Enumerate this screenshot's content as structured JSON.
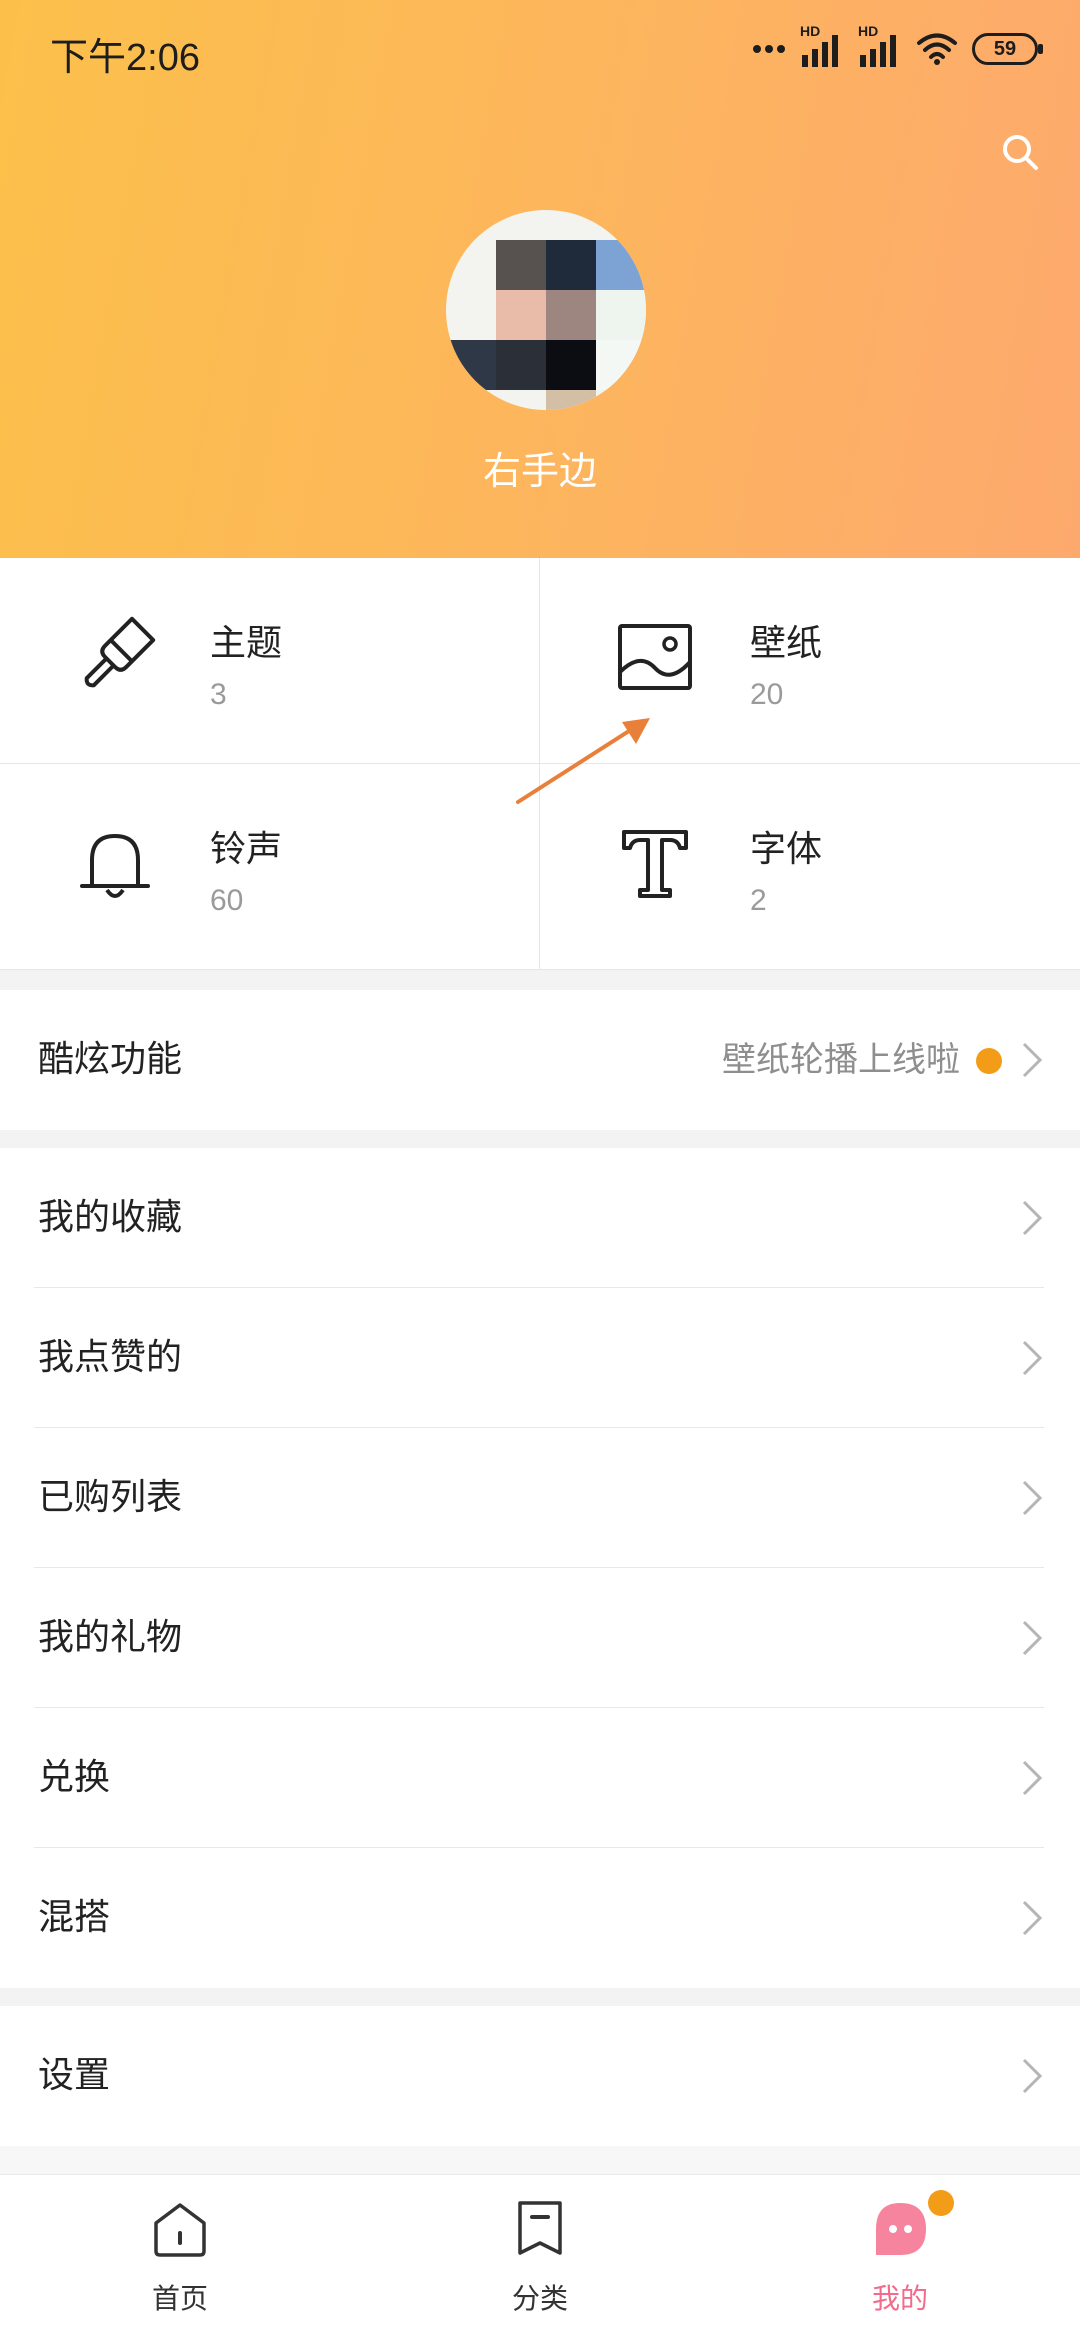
{
  "status_bar": {
    "time": "下午2:06",
    "network_labels": [
      "HD",
      "HD"
    ],
    "battery": "59"
  },
  "header": {
    "username": "右手边",
    "search_icon": "search-icon",
    "gradient_colors": [
      "#fcc04a",
      "#fda96e"
    ]
  },
  "quick_grid": [
    {
      "title": "主题",
      "count": "3",
      "icon": "brush-icon"
    },
    {
      "title": "壁纸",
      "count": "20",
      "icon": "image-icon"
    },
    {
      "title": "铃声",
      "count": "60",
      "icon": "bell-icon"
    },
    {
      "title": "字体",
      "count": "2",
      "icon": "font-icon"
    }
  ],
  "features_row": {
    "label": "酷炫功能",
    "value": "壁纸轮播上线啦",
    "dot_color": "#f39c17"
  },
  "list": [
    {
      "label": "我的收藏"
    },
    {
      "label": "我点赞的"
    },
    {
      "label": "已购列表"
    },
    {
      "label": "我的礼物"
    },
    {
      "label": "兑换"
    },
    {
      "label": "混搭"
    }
  ],
  "settings_row": {
    "label": "设置"
  },
  "bottom_nav": [
    {
      "label": "首页",
      "icon": "home-icon",
      "active": false
    },
    {
      "label": "分类",
      "icon": "category-icon",
      "active": false
    },
    {
      "label": "我的",
      "icon": "profile-icon",
      "active": true
    }
  ],
  "colors": {
    "accent": "#f06b8c",
    "badge": "#f39c17",
    "annotation_arrow": "#e8803a"
  }
}
